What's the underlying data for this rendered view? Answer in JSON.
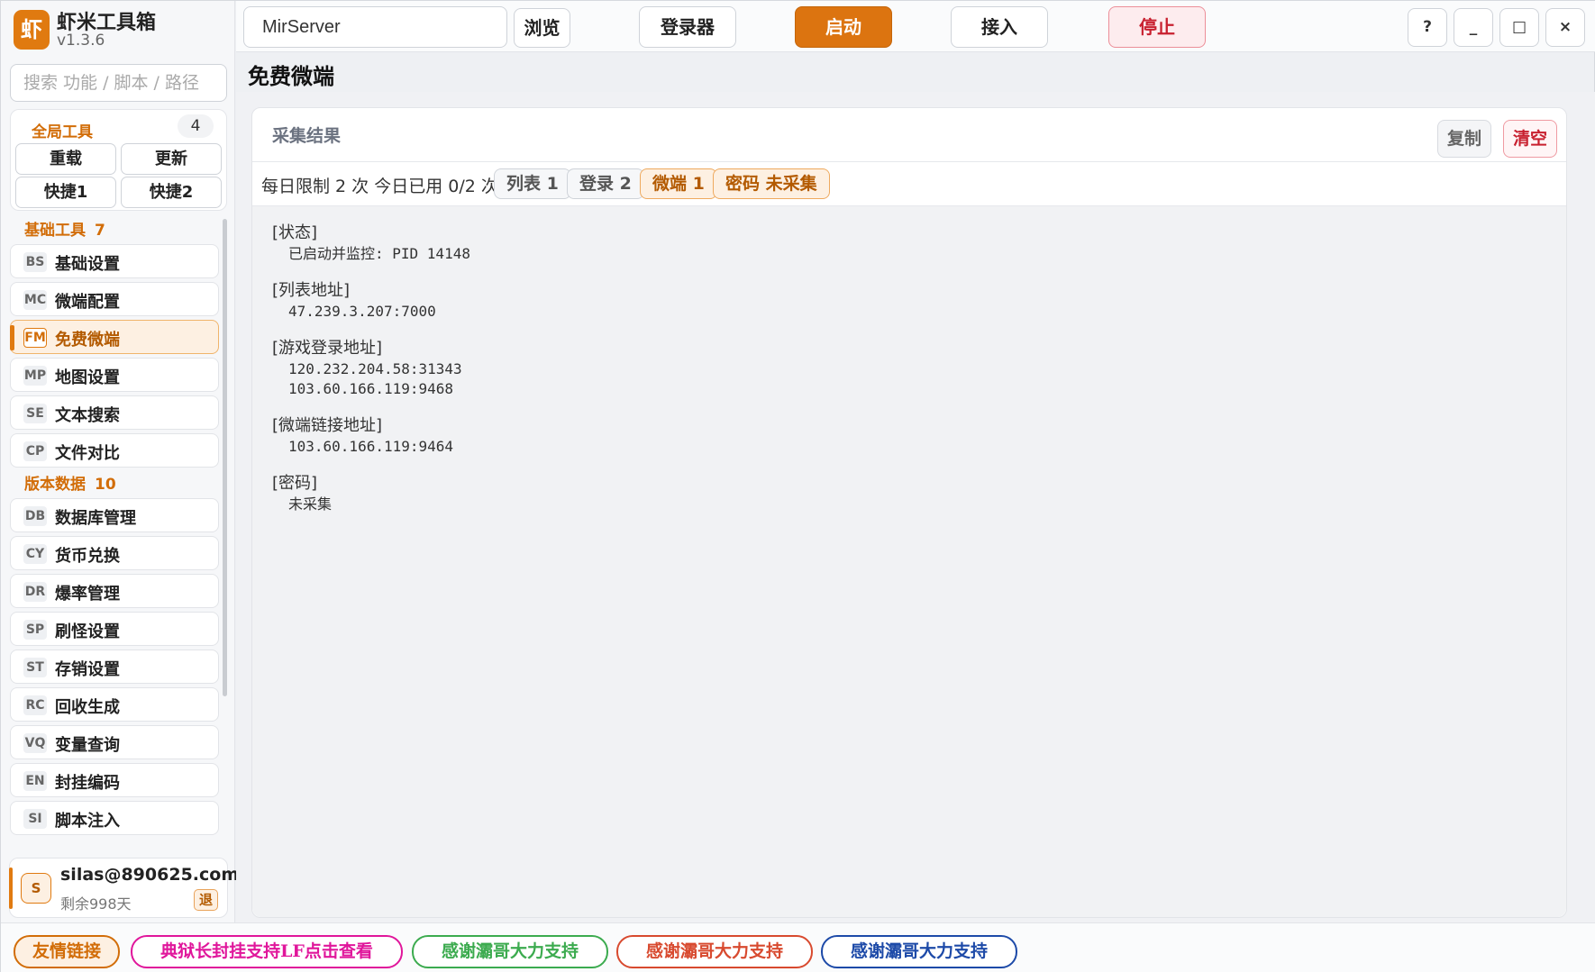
{
  "brand": {
    "logo_char": "虾",
    "name": "虾米工具箱",
    "version": "v1.3.6"
  },
  "search": {
    "placeholder": "搜索 功能 / 脚本 / 路径"
  },
  "global_tools": {
    "title": "全局工具",
    "count": "4",
    "buttons": [
      "重载",
      "更新",
      "快捷1",
      "快捷2"
    ]
  },
  "nav": {
    "sections": [
      {
        "title": "基础工具",
        "count": "7",
        "items": [
          {
            "code": "BS",
            "label": "基础设置"
          },
          {
            "code": "MC",
            "label": "微端配置"
          },
          {
            "code": "FM",
            "label": "免费微端",
            "active": true
          },
          {
            "code": "MP",
            "label": "地图设置"
          },
          {
            "code": "SE",
            "label": "文本搜索"
          },
          {
            "code": "CP",
            "label": "文件对比"
          }
        ]
      },
      {
        "title": "版本数据",
        "count": "10",
        "items": [
          {
            "code": "DB",
            "label": "数据库管理"
          },
          {
            "code": "CY",
            "label": "货币兑换"
          },
          {
            "code": "DR",
            "label": "爆率管理"
          },
          {
            "code": "SP",
            "label": "刷怪设置"
          },
          {
            "code": "ST",
            "label": "存销设置"
          },
          {
            "code": "RC",
            "label": "回收生成"
          },
          {
            "code": "VQ",
            "label": "变量查询"
          },
          {
            "code": "EN",
            "label": "封挂编码"
          },
          {
            "code": "SI",
            "label": "脚本注入"
          }
        ]
      }
    ]
  },
  "user": {
    "avatar": "S",
    "email": "silas@890625.com",
    "days_left": "剩余998天",
    "logout_label": "退"
  },
  "topbar": {
    "path_value": "MirServer",
    "browse_label": "浏览",
    "login_label": "登录器",
    "start_label": "启动",
    "connect_label": "接入",
    "stop_label": "停止",
    "help_label": "?",
    "minimize_label": "_",
    "maximize_label": "□",
    "close_label": "×"
  },
  "page": {
    "title": "免费微端"
  },
  "panel": {
    "title": "采集结果",
    "copy_label": "复制",
    "clear_label": "清空",
    "limit_text": "每日限制 2 次 今日已用 0/2 次。",
    "chips": [
      {
        "label": "列表 1",
        "warn": false
      },
      {
        "label": "登录 2",
        "warn": false
      },
      {
        "label": "微端 1",
        "warn": true
      },
      {
        "label": "密码 未采集",
        "warn": true
      }
    ],
    "sections": [
      {
        "head": "[状态]",
        "lines": [
          "已启动并监控: PID 14148"
        ]
      },
      {
        "head": "[列表地址]",
        "lines": [
          "47.239.3.207:7000"
        ]
      },
      {
        "head": "[游戏登录地址]",
        "lines": [
          "120.232.204.58:31343",
          "103.60.166.119:9468"
        ]
      },
      {
        "head": "[微端链接地址]",
        "lines": [
          "103.60.166.119:9464"
        ]
      },
      {
        "head": "[密码]",
        "lines": [
          "未采集"
        ]
      }
    ]
  },
  "footer": {
    "links": [
      {
        "label": "友情链接",
        "color": "#d26d08",
        "bg": "#fdf0e2"
      },
      {
        "label": "典狱长封挂支持LF点击查看",
        "color": "#e0169b",
        "bg": "#ffffff"
      },
      {
        "label": "感谢灞哥大力支持",
        "color": "#3cab4f",
        "bg": "#ffffff"
      },
      {
        "label": "感谢灞哥大力支持",
        "color": "#d84a2f",
        "bg": "#ffffff"
      },
      {
        "label": "感谢灞哥大力支持",
        "color": "#1d4aa8",
        "bg": "#ffffff"
      }
    ]
  },
  "colors": {
    "accent": "#e07a10",
    "danger": "#c8202f"
  }
}
